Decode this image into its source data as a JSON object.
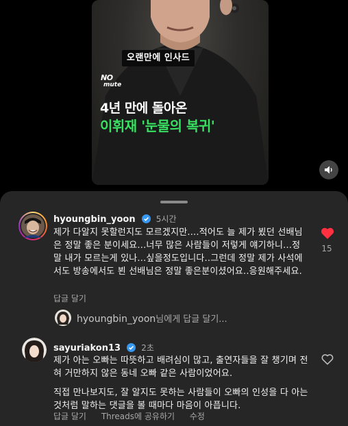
{
  "video": {
    "caption_box": "오랜만에 인사드",
    "logo_line1": "NO",
    "logo_line2": "mute",
    "headline1": "4년 만에 돌아온",
    "headline2": "이휘재 '눈물의 복귀'",
    "sound_icon": "speaker-icon"
  },
  "comments": [
    {
      "username": "hyoungbin_yoon",
      "time": "5시간",
      "text": "제가 다알지 못할런지도 모르겠지만....적어도 늘 제가 뵜던 선배님은 정말 좋은 분이세요...너무 많은 사람들이 저렇게 얘기하니...정말 내가 모르는게 있나...싶을정도입니다..그런데 정말 제가 사석에서도 방송에서도 뵌 선배님은 정말 좋은분이셨어요..응원해주세요.",
      "reply_label": "답글 달기",
      "likes": "15",
      "liked": true,
      "colors": {
        "like": "#ff3040",
        "ring": "#d62976"
      }
    },
    {
      "username": "sayuriakon13",
      "time": "2초",
      "paragraph1": "제가 아는 오빠는 따뜻하고 배려심이 많고, 출연자들을 잘 챙기며 전혀 거만하지 않은 동네 오빠 같은 사람이었어요.",
      "paragraph2": "직접 만나보지도, 잘 알지도 못하는 사람들이 오빠의 인성을 다 아는 것처럼 말하는 댓글을 볼 때마다 마음이 아픕니다.",
      "reply_label": "답글 달기",
      "share_label": "Threads에 공유하기",
      "edit_label": "수정",
      "liked": false
    }
  ],
  "reply_input": {
    "username": "hyoungbin_yoon",
    "suffix": "님에게 답글 달기..."
  },
  "colors": {
    "verified": "#3897f0",
    "sheet": "#262626",
    "accent_green": "#39e062"
  }
}
